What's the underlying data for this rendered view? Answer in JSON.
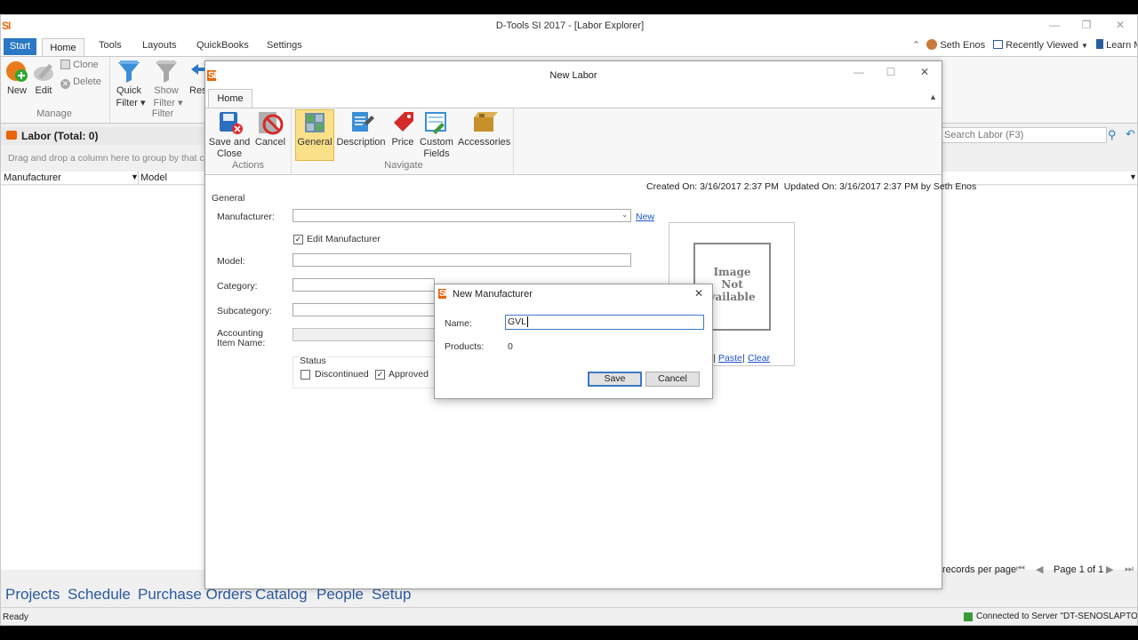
{
  "app": {
    "title": "D-Tools SI 2017 - [Labor Explorer]",
    "logo": "SI",
    "tabs": [
      "Start",
      "Home",
      "Tools",
      "Layouts",
      "QuickBooks",
      "Settings"
    ],
    "user": "Seth Enos",
    "recently_viewed": "Recently Viewed",
    "learn_more": "Learn More"
  },
  "ribbon": {
    "new": "New",
    "edit": "Edit",
    "clone": "Clone",
    "delete": "Delete",
    "manage_group": "Manage",
    "quick_filter": "Quick",
    "quick_filter2": "Filter",
    "show_filter": "Show",
    "show_filter2": "Filter",
    "filter_group": "Filter",
    "reset_partial": "Res"
  },
  "explorer": {
    "header": "Labor (Total: 0)",
    "group_hint": "Drag and drop a column here to group by that co",
    "columns": [
      "Manufacturer",
      "Model"
    ],
    "search_placeholder": "Search Labor (F3)",
    "records_per_page": "records per page",
    "page": "Page 1 of 1"
  },
  "bottom_nav": [
    "Projects",
    "Schedule",
    "Purchase Orders",
    "Catalog",
    "People",
    "Setup"
  ],
  "status": {
    "left": "Ready",
    "right": "Connected to Server \"DT-SENOSLAPTOP\""
  },
  "new_labor": {
    "title": "New Labor",
    "home_tab": "Home",
    "save_close": "Save and",
    "save_close2": "Close",
    "cancel": "Cancel",
    "actions_group": "Actions",
    "general": "General",
    "description": "Description",
    "price": "Price",
    "custom_fields": "Custom",
    "custom_fields2": "Fields",
    "accessories": "Accessories",
    "navigate_group": "Navigate",
    "created": "Created On: 3/16/2017 2:37 PM",
    "updated": "Updated On: 3/16/2017 2:37 PM by Seth Enos",
    "section": "General",
    "manufacturer_label": "Manufacturer:",
    "new_link": "New",
    "edit_manufacturer": "Edit Manufacturer",
    "model_label": "Model:",
    "category_label": "Category:",
    "subcategory_label": "Subcategory:",
    "accounting_label": "Accounting",
    "accounting_label2": "Item Name:",
    "status_group": "Status",
    "discontinued": "Discontinued",
    "approved": "Approved",
    "image_text": "Image",
    "image_text2": "Not",
    "image_text3": "vailable",
    "paste": "Paste",
    "clear": "Clear"
  },
  "dialog": {
    "title": "New Manufacturer",
    "name_label": "Name:",
    "name_value": "GVL",
    "products_label": "Products:",
    "products_value": "0",
    "save": "Save",
    "cancel": "Cancel"
  },
  "colors": {
    "accent": "#2b78c5",
    "link": "#1a55c8",
    "logo": "#e8650a"
  }
}
